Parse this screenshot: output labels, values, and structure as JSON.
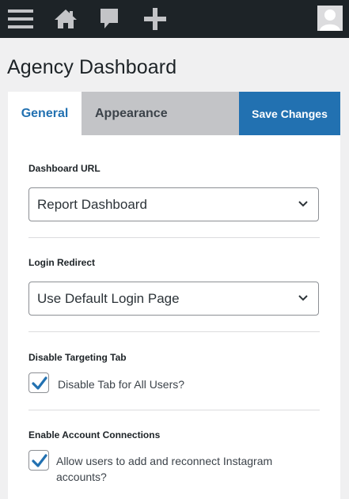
{
  "adminbar": {
    "icons": [
      "menu-icon",
      "home-icon",
      "comment-icon",
      "plus-icon",
      "avatar"
    ],
    "color": "#1d2327"
  },
  "page": {
    "title": "Agency Dashboard"
  },
  "tabs": [
    {
      "label": "General",
      "active": true
    },
    {
      "label": "Appearance",
      "active": false
    }
  ],
  "save_button": {
    "label": "Save Changes",
    "color": "#2271b1"
  },
  "settings": {
    "dashboard_url": {
      "label": "Dashboard URL",
      "selected": "Report Dashboard"
    },
    "login_redirect": {
      "label": "Login Redirect",
      "selected": "Use Default Login Page"
    },
    "disable_targeting": {
      "label": "Disable Targeting Tab",
      "option": "Disable Tab for All Users?",
      "checked": true
    },
    "account_connections": {
      "label": "Enable Account Connections",
      "option": "Allow users to add and reconnect Instagram accounts?",
      "checked": true
    }
  },
  "colors": {
    "accent": "#2271b1",
    "inactive_tab": "#c3c4c7",
    "background": "#f0f0f1"
  }
}
